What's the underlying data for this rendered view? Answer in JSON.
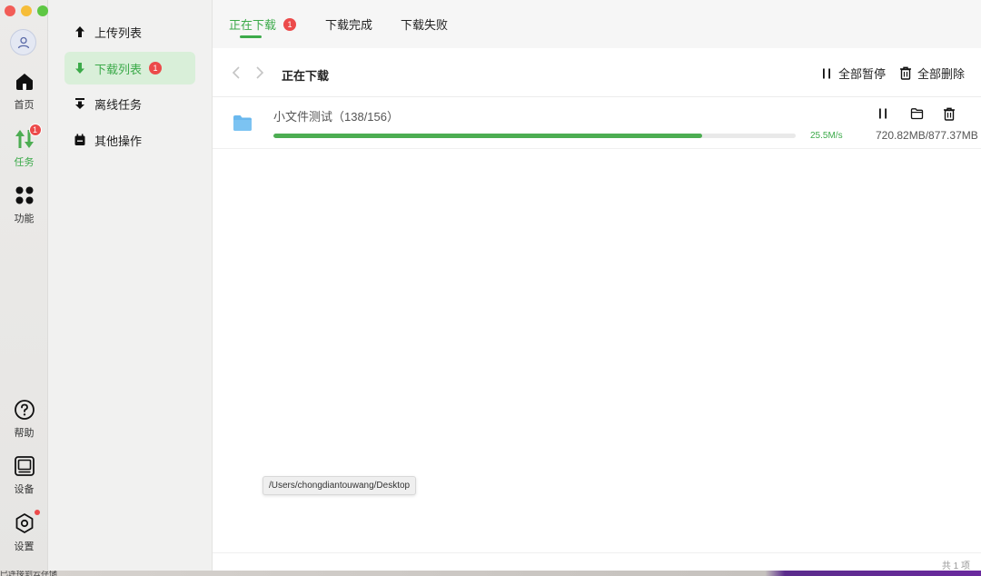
{
  "rail": {
    "items": [
      {
        "label": "首页"
      },
      {
        "label": "任务",
        "badge": "1"
      },
      {
        "label": "功能"
      },
      {
        "label": "帮助"
      },
      {
        "label": "设备"
      },
      {
        "label": "设置"
      }
    ]
  },
  "sidebar": {
    "items": [
      {
        "label": "上传列表",
        "icon": "upload-arrow-icon"
      },
      {
        "label": "下载列表",
        "icon": "download-arrow-icon",
        "badge": "1"
      },
      {
        "label": "离线任务",
        "icon": "offline-download-icon"
      },
      {
        "label": "其他操作",
        "icon": "calendar-icon"
      }
    ]
  },
  "tabs": [
    {
      "label": "正在下载",
      "badge": "1"
    },
    {
      "label": "下载完成"
    },
    {
      "label": "下载失败"
    }
  ],
  "toolbar": {
    "title": "正在下载",
    "pause_all": "全部暂停",
    "delete_all": "全部删除"
  },
  "task": {
    "name": "小文件测试（138/156）",
    "progress": 0.82,
    "speed": "25.5M/s",
    "size": "720.82MB/877.37MB"
  },
  "tooltip": "/Users/chongdiantouwang/Desktop",
  "footer": {
    "count": "共 1 项"
  },
  "desktop": {
    "text": "已连接到云存储"
  },
  "colors": {
    "accent": "#3caa4a",
    "badge": "#ec4a4a",
    "folder": "#6ab8ee",
    "active_bg": "#d9efd9"
  }
}
